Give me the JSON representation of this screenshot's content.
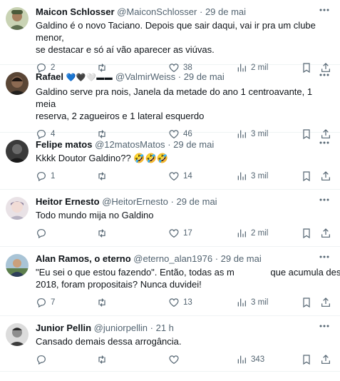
{
  "tweets": [
    {
      "name": "Maicon Schlosser",
      "emojis": "",
      "handle": "@MaiconSchlosser",
      "dot": "·",
      "time": "29 de mai",
      "text_lines": [
        "Galdino é o novo Taciano. Depois que sair daqui, vai ir pra um clube menor,",
        "se destacar e só aí vão aparecer as viúvas."
      ],
      "replies": "2",
      "retweets": "",
      "likes": "38",
      "views": "2 mil",
      "avatar_color": "#6b7b5a"
    },
    {
      "name": "Rafael",
      "emojis": "💙🖤🤍▬▬",
      "handle": "@ValmirWeiss",
      "dot": "·",
      "time": "29 de mai",
      "text_lines": [
        "Galdino serve pra nois, Janela da metade do ano 1  centroavante, 1 meia",
        "reserva, 2 zagueiros e 1 lateral esquerdo"
      ],
      "replies": "4",
      "retweets": "",
      "likes": "46",
      "views": "3 mil",
      "avatar_color": "#3b2a22"
    },
    {
      "name": "Felipe matos",
      "emojis": "",
      "handle": "@12matosMatos",
      "dot": "·",
      "time": "29 de mai",
      "text_lines": [
        "Kkkk Doutor Galdino?? 🤣🤣🤣"
      ],
      "replies": "1",
      "retweets": "",
      "likes": "14",
      "views": "3 mil",
      "avatar_color": "#2f2f2f"
    },
    {
      "name": "Heitor Ernesto",
      "emojis": "",
      "handle": "@HeitorErnesto",
      "dot": "·",
      "time": "29 de mai",
      "text_lines": [
        "Todo mundo mija no Galdino"
      ],
      "replies": "",
      "retweets": "",
      "likes": "17",
      "views": "2 mil",
      "avatar_color": "#d9c9c4"
    },
    {
      "name": "Alan Ramos, o eterno",
      "emojis": "",
      "handle": "@eterno_alan1976",
      "dot": "·",
      "time": "29 de mai",
      "text_lines": [
        "\"Eu sei o que estou fazendo\". Então, todas as m              que acumula desde",
        "2018, foram propositais? Nunca duvidei!"
      ],
      "replies": "7",
      "retweets": "",
      "likes": "13",
      "views": "3 mil",
      "avatar_color": "#7ea0b8"
    },
    {
      "name": "Junior Pellin",
      "emojis": "",
      "handle": "@juniorpellin",
      "dot": "·",
      "time": "21 h",
      "text_lines": [
        "Cansado demais dessa arrogância."
      ],
      "replies": "",
      "retweets": "",
      "likes": "",
      "views": "343",
      "avatar_color": "#9a9a9a"
    }
  ]
}
